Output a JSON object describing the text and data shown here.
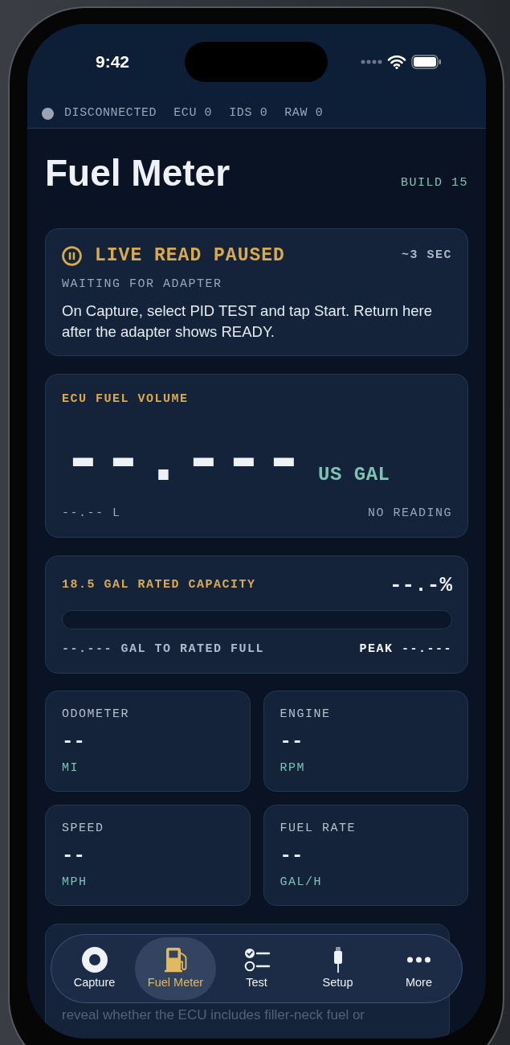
{
  "status_bar": {
    "time": "9:42"
  },
  "connection": {
    "status": "DISCONNECTED",
    "connected": false,
    "counters": [
      "ECU 0",
      "IDS 0",
      "RAW 0"
    ]
  },
  "header": {
    "title": "Fuel Meter",
    "build": "BUILD 15"
  },
  "live_read": {
    "paused": true,
    "title": "LIVE READ PAUSED",
    "interval": "~3 SEC",
    "subtitle": "WAITING FOR ADAPTER",
    "message": "On Capture, select PID TEST and tap Start. Return here after the adapter shows READY."
  },
  "fuel_volume": {
    "label": "ECU FUEL VOLUME",
    "reading": "--.---",
    "unit": "US GAL",
    "liters": "--.-- L",
    "status": "NO READING"
  },
  "capacity": {
    "label": "18.5 GAL RATED CAPACITY",
    "percent": "--.-%",
    "level": 0,
    "remaining": "--.--- GAL TO RATED FULL",
    "peak": "PEAK --.---"
  },
  "metrics": [
    {
      "label": "ODOMETER",
      "value": "--",
      "unit": "MI"
    },
    {
      "label": "ENGINE",
      "value": "--",
      "unit": "RPM"
    },
    {
      "label": "SPEED",
      "value": "--",
      "unit": "MPH"
    },
    {
      "label": "FUEL RATE",
      "value": "--",
      "unit": "GAL/H"
    }
  ],
  "note_card": {
    "text": "reveal whether the ECU includes filler-neck fuel or"
  },
  "tab_bar": {
    "tabs": [
      {
        "label": "Capture",
        "kind": "capture",
        "selected": false
      },
      {
        "label": "Fuel Meter",
        "kind": "fuel",
        "selected": true
      },
      {
        "label": "Test",
        "kind": "checklist",
        "selected": false
      },
      {
        "label": "Setup",
        "kind": "plug",
        "selected": false
      },
      {
        "label": "More",
        "kind": "more",
        "selected": false
      }
    ]
  }
}
